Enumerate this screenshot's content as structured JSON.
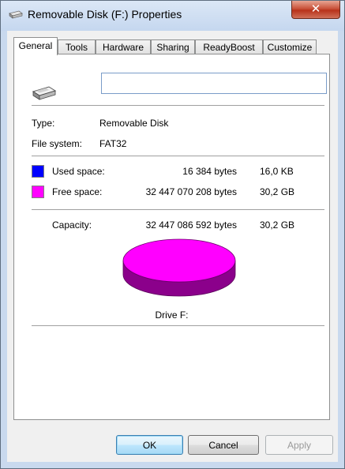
{
  "window": {
    "title": "Removable Disk (F:) Properties",
    "close_glyph": "✕"
  },
  "tabs": [
    {
      "label": "General",
      "active": true
    },
    {
      "label": "Tools"
    },
    {
      "label": "Hardware"
    },
    {
      "label": "Sharing"
    },
    {
      "label": "ReadyBoost"
    },
    {
      "label": "Customize"
    }
  ],
  "general": {
    "name_value": "",
    "type_label": "Type:",
    "type_value": "Removable Disk",
    "fs_label": "File system:",
    "fs_value": "FAT32",
    "used": {
      "label": "Used space:",
      "bytes": "16 384 bytes",
      "size": "16,0 KB",
      "color": "#0000ff"
    },
    "free": {
      "label": "Free space:",
      "bytes": "32 447 070 208 bytes",
      "size": "30,2 GB",
      "color": "#ff00ff"
    },
    "capacity": {
      "label": "Capacity:",
      "bytes": "32 447 086 592 bytes",
      "size": "30,2 GB"
    },
    "drive_label": "Drive F:",
    "pie": {
      "used_fraction": 5e-07,
      "free_color": "#ff00ff",
      "free_side_color": "#8b008b",
      "used_color": "#0000ff"
    }
  },
  "buttons": {
    "ok": "OK",
    "cancel": "Cancel",
    "apply": "Apply"
  },
  "icons": {
    "title": "removable-drive-icon",
    "panel": "removable-drive-icon"
  }
}
